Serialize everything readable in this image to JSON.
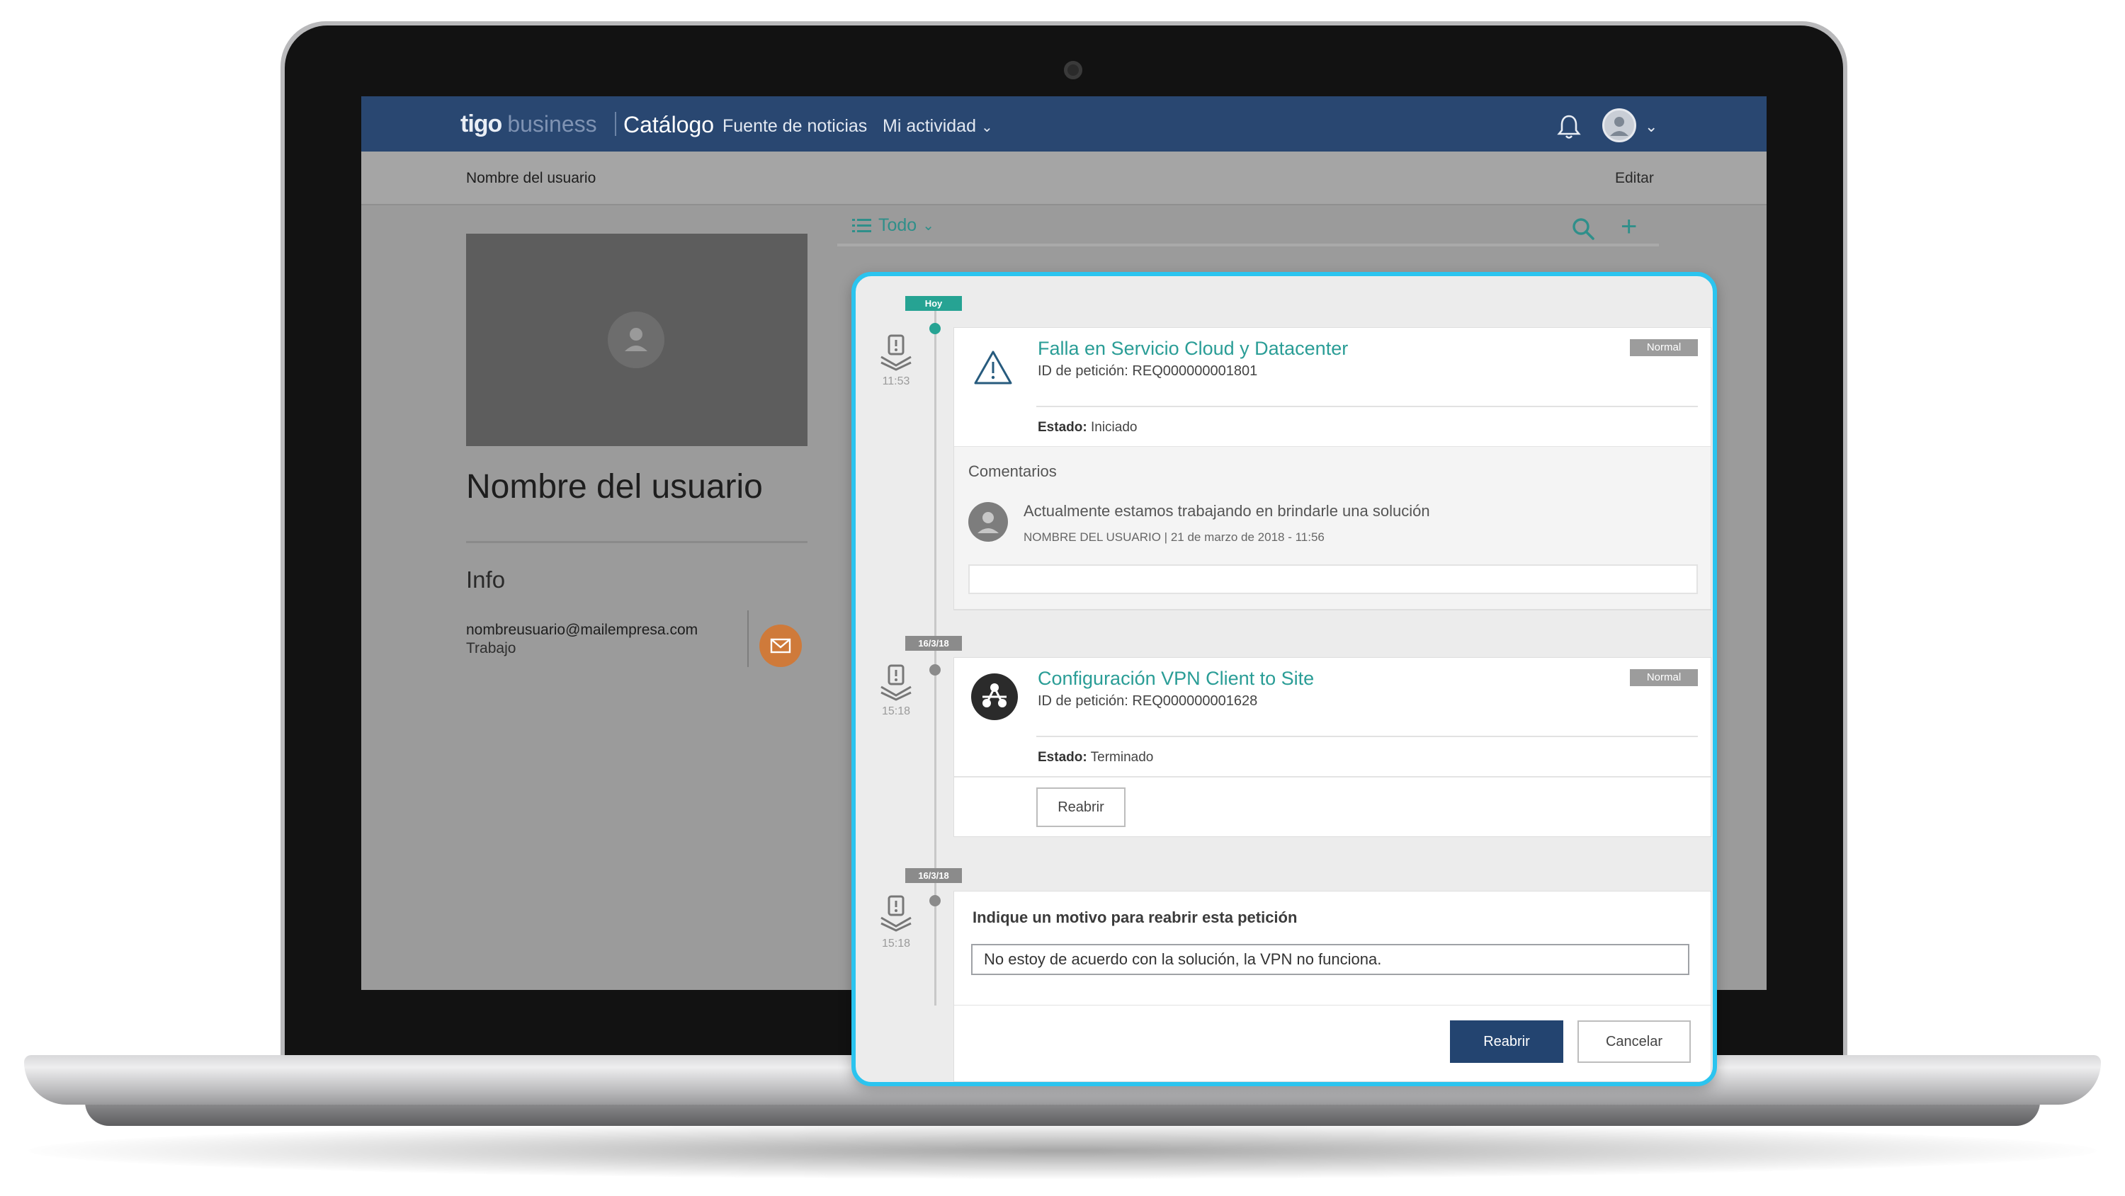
{
  "header": {
    "logo_primary": "tigo",
    "logo_secondary": "business",
    "catalog_label": "Catálogo",
    "nav_items": [
      "Fuente de noticias",
      "Mi actividad"
    ],
    "accent_color": "#294771"
  },
  "subheader": {
    "user_name": "Nombre del usuario",
    "edit_label": "Editar"
  },
  "profile": {
    "name": "Nombre del usuario",
    "info_label": "Info",
    "email": "nombreusuario@mailempresa.com",
    "email_type": "Trabajo"
  },
  "feed": {
    "filter_label": "Todo",
    "accent_color": "#2f8f8a",
    "highlight_color": "#2bc4ef",
    "items": [
      {
        "date_tag": "Hoy",
        "time": "11:53",
        "title": "Falla en Servicio Cloud y Datacenter",
        "request_id": "ID de petición: REQ000000001801",
        "status_label": "Estado:",
        "status_value": "Iniciado",
        "priority": "Normal",
        "icon": "warning-icon"
      },
      {
        "date_tag": "16/3/18",
        "time": "15:18",
        "title": "Configuración VPN Client to Site",
        "request_id": "ID de petición: REQ000000001628",
        "status_label": "Estado:",
        "status_value": "Terminado",
        "priority": "Normal",
        "icon": "network-icon",
        "action_label": "Reabrir"
      },
      {
        "date_tag": "16/3/18",
        "time": "15:18"
      }
    ],
    "comments": {
      "label": "Comentarios",
      "text": "Actualmente estamos trabajando en brindarle una solución",
      "meta": "NOMBRE DEL USUARIO | 21 de marzo de 2018 - 11:56"
    },
    "reopen": {
      "title": "Indique un motivo para reabrir esta petición",
      "value": "No estoy de acuerdo con la solución, la VPN no funciona.",
      "confirm_label": "Reabrir",
      "cancel_label": "Cancelar"
    }
  }
}
